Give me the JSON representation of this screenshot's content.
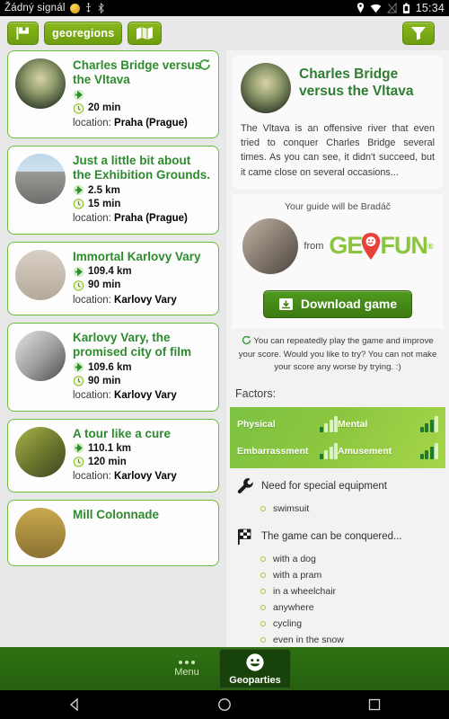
{
  "statusbar": {
    "carrier": "Žádný signál",
    "time": "15:34",
    "icons": [
      "coin-icon",
      "usb-icon",
      "bluetooth-icon",
      "location-pin-icon",
      "wifi-icon",
      "no-signal-icon",
      "battery-icon"
    ]
  },
  "toolbar": {
    "flag_button": "flag-icon",
    "region_label": "georegions",
    "map_button": "map-icon",
    "filter_button": "filter-icon"
  },
  "list": {
    "items": [
      {
        "title": "Charles Bridge versus the Vltava",
        "distance": "",
        "duration": "20 min",
        "location_label": "location:",
        "location": "Praha (Prague)",
        "has_refresh": true,
        "thumb": "charles-bridge-thumb"
      },
      {
        "title": "Just a little bit about the Exhibition Grounds.",
        "distance": "2.5 km",
        "duration": "15 min",
        "location_label": "location:",
        "location": "Praha (Prague)",
        "has_refresh": false,
        "thumb": "exhibition-grounds-thumb"
      },
      {
        "title": "Immortal Karlovy Vary",
        "distance": "109.4 km",
        "duration": "90 min",
        "location_label": "location:",
        "location": "Karlovy Vary",
        "has_refresh": false,
        "thumb": "crosses-thumb"
      },
      {
        "title": "Karlovy Vary, the promised city of film",
        "distance": "109.6 km",
        "duration": "90 min",
        "location_label": "location:",
        "location": "Karlovy Vary",
        "has_refresh": false,
        "thumb": "film-festival-thumb"
      },
      {
        "title": "A tour like a cure",
        "distance": "110.1 km",
        "duration": "120 min",
        "location_label": "location:",
        "location": "Karlovy Vary",
        "has_refresh": false,
        "thumb": "forest-walk-thumb"
      },
      {
        "title": "Mill Colonnade",
        "distance": "",
        "duration": "",
        "location_label": "",
        "location": "",
        "has_refresh": false,
        "thumb": "mill-colonnade-thumb"
      }
    ]
  },
  "detail": {
    "title": "Charles Bridge versus the Vltava",
    "description": "The Vltava is an offensive river that even tried to conquer Charles Bridge several times. As you can see, it didn't succeed, but it came close on several occasions...",
    "guide_caption": "Your guide will be Bradáč",
    "from_label": "from",
    "brand_left": "GE",
    "brand_right": "FUN",
    "brand_reg": "®",
    "download_label": "Download game",
    "note": "You can repeatedly play the game and improve your score. Would you like to try? You can not make your score any worse by trying. :)",
    "factors_label": "Factors:",
    "factors": [
      {
        "name": "Physical",
        "level": 1,
        "max": 4
      },
      {
        "name": "Mental",
        "level": 3,
        "max": 4
      },
      {
        "name": "Embarrassment",
        "level": 1,
        "max": 4
      },
      {
        "name": "Amusement",
        "level": 3,
        "max": 4
      }
    ],
    "equipment_title": "Need for special equipment",
    "equipment": [
      "swimsuit"
    ],
    "conquer_title": "The game can be conquered...",
    "conquer": [
      "with a dog",
      "with a pram",
      "in a wheelchair",
      "anywhere",
      "cycling",
      "even in the snow"
    ]
  },
  "tabbar": {
    "menu_label": "Menu",
    "geoparties_label": "Geoparties"
  },
  "navbar": {
    "back": "back-icon",
    "home": "home-icon",
    "recents": "recents-icon"
  },
  "colors": {
    "brand_green": "#8bc53f",
    "dark_green": "#2e7d32",
    "card_border": "#6cbb3c",
    "toolbar_green": "#7aa818"
  }
}
